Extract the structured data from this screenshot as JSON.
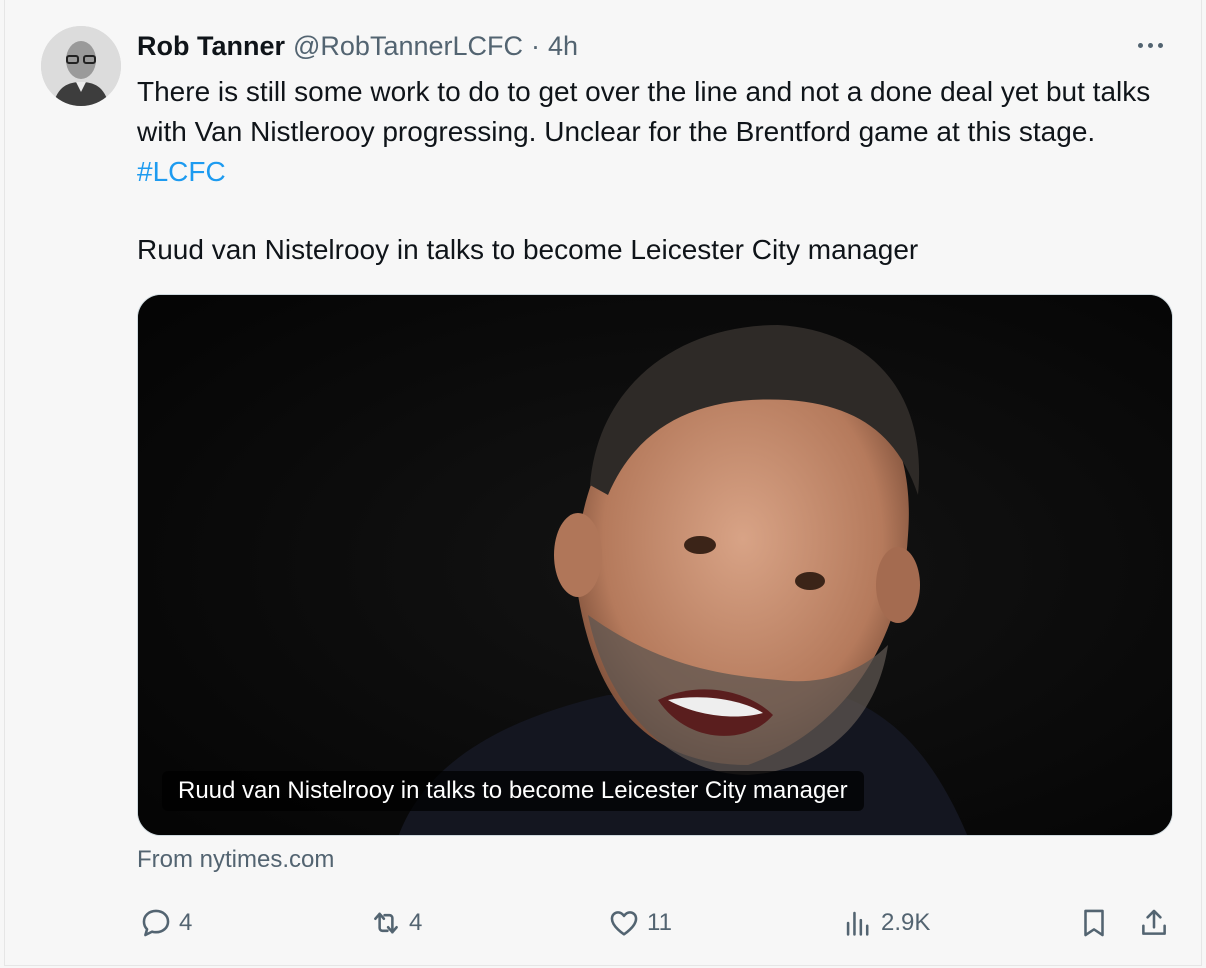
{
  "tweet": {
    "author_name": "Rob Tanner",
    "handle": "@RobTannerLCFC",
    "separator": "·",
    "time": "4h",
    "text": "There is still some work to do to get over the line and not a done deal yet but talks with Van Nistlerooy progressing. Unclear for the Brentford game at this stage.",
    "hashtag": "#LCFC",
    "headline": "Ruud van Nistelrooy in talks to become Leicester City manager"
  },
  "card": {
    "caption": "Ruud van Nistelrooy in talks to become Leicester City manager",
    "source": "From nytimes.com"
  },
  "actions": {
    "replies": "4",
    "reposts": "4",
    "likes": "11",
    "views": "2.9K"
  },
  "icons": {
    "more": "more-icon",
    "reply": "reply-icon",
    "repost": "repost-icon",
    "like": "heart-icon",
    "views": "views-icon",
    "bookmark": "bookmark-icon",
    "share": "share-icon"
  },
  "colors": {
    "link": "#1d9bf0",
    "secondary_text": "#536471",
    "background": "#f7f7f7"
  }
}
